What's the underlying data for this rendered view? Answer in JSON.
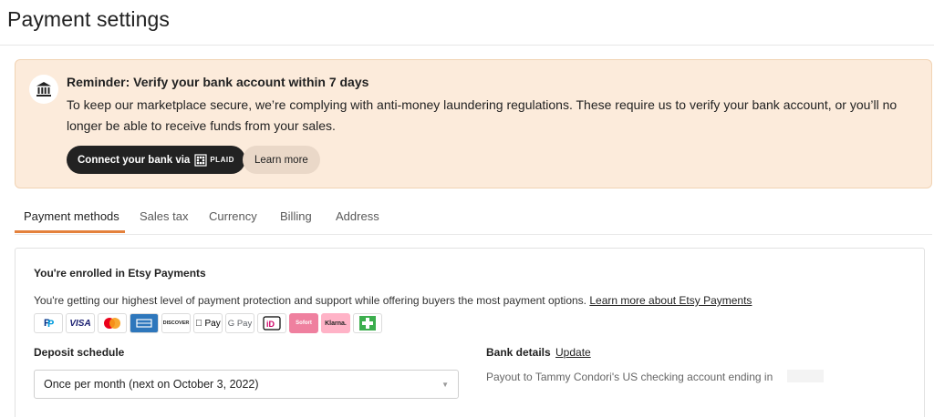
{
  "header": {
    "title": "Payment settings"
  },
  "banner": {
    "title": "Reminder: Verify your bank account within 7 days",
    "body": "To keep our marketplace secure, we’re complying with anti-money laundering regulations. These require us to verify your bank account, or you’ll no longer be able to receive funds from your sales.",
    "connect_label": "Connect your bank via",
    "plaid_label": "PLAID",
    "learn_more_label": "Learn more"
  },
  "tabs": [
    {
      "label": "Payment methods",
      "active": true
    },
    {
      "label": "Sales tax",
      "active": false
    },
    {
      "label": "Currency",
      "active": false
    },
    {
      "label": "Billing",
      "active": false
    },
    {
      "label": "Address",
      "active": false
    }
  ],
  "enrollment": {
    "title": "You're enrolled in Etsy Payments",
    "text": "You're getting our highest level of payment protection and support while offering buyers the most payment options.",
    "link": "Learn more about Etsy Payments"
  },
  "payment_icons": [
    {
      "name": "paypal-icon",
      "label": "PayPal",
      "color": "#003087"
    },
    {
      "name": "visa-icon",
      "label": "VISA",
      "color": "#1a1f71"
    },
    {
      "name": "mastercard-icon",
      "label": "",
      "color": "#eb001b"
    },
    {
      "name": "amex-icon",
      "label": "",
      "color": "#2e77bc"
    },
    {
      "name": "discover-icon",
      "label": "DISCOVER",
      "color": "#e55c20"
    },
    {
      "name": "apple-pay-icon",
      "label": " Pay",
      "color": "#000000"
    },
    {
      "name": "google-pay-icon",
      "label": "G Pay",
      "color": "#5f6368"
    },
    {
      "name": "ideal-icon",
      "label": "iD",
      "color": "#cc0066"
    },
    {
      "name": "sofort-icon",
      "label": "Sofort",
      "color": "#ef809f"
    },
    {
      "name": "klarna-icon",
      "label": "Klarna.",
      "color": "#ffb3c7"
    },
    {
      "name": "giropay-icon",
      "label": "",
      "color": "#3cae4e"
    }
  ],
  "deposit": {
    "label": "Deposit schedule",
    "selected": "Once per month (next on October 3, 2022)"
  },
  "bank": {
    "label": "Bank details",
    "update_label": "Update",
    "payout_text": "Payout to Tammy Condori's US checking account ending in"
  },
  "colors": {
    "banner_bg": "#fcebdb",
    "tab_accent": "#e4813c",
    "primary_button": "#222222"
  }
}
